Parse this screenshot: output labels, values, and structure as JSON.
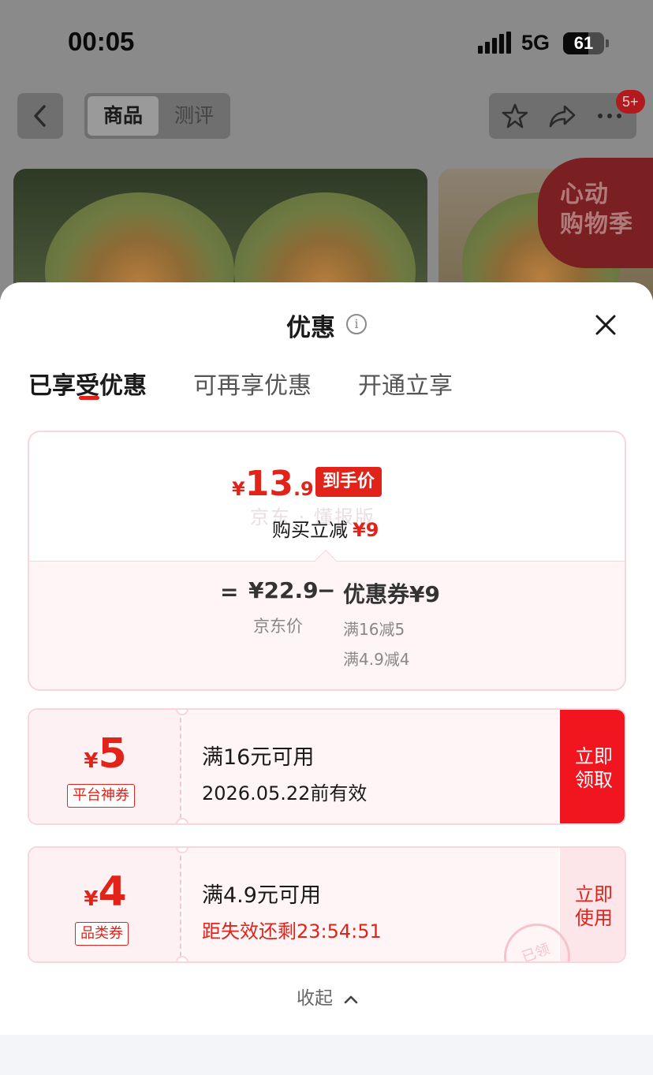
{
  "status_bar": {
    "time": "00:05",
    "network": "5G",
    "battery": "61"
  },
  "top_nav": {
    "tabs": [
      "商品",
      "测评"
    ],
    "active_tab": "商品",
    "more_badge": "5+",
    "promo_banner": "心动\n购物季"
  },
  "sheet": {
    "title": "优惠",
    "tabs": [
      {
        "label": "已享受优惠",
        "active": true
      },
      {
        "label": "可再享优惠",
        "active": false
      },
      {
        "label": "开通立享",
        "active": false
      }
    ]
  },
  "summary": {
    "price_yen": "¥",
    "price_int": "13",
    "price_dec": ".9",
    "price_tag": "到手价",
    "watermark": "京东 · 懂报版",
    "reduce_label": "购买立减",
    "reduce_value": "¥9",
    "equals": "=",
    "jd_price": "¥22.9",
    "jd_label": "京东价",
    "minus": "−",
    "coupon_total": "优惠券¥9",
    "rules": [
      "满16减5",
      "满4.9减4"
    ]
  },
  "coupons": [
    {
      "yen": "¥",
      "amount": "5",
      "type": "平台神券",
      "condition": "满16元可用",
      "subtext": "2026.05.22前有效",
      "button": "立即\n领取",
      "button_style": "solid"
    },
    {
      "yen": "¥",
      "amount": "4",
      "type": "品类券",
      "condition": "满4.9元可用",
      "subtext": "距失效还剩23:54:51",
      "button": "立即\n使用",
      "button_style": "soft",
      "stamp": "已领"
    }
  ],
  "collapse_label": "收起",
  "colors": {
    "accent": "#e2231a",
    "coupon_border": "#f8d6dc",
    "coupon_bg": "#fff5f7"
  },
  "icons": [
    "back-icon",
    "star-icon",
    "share-icon",
    "more-icon",
    "info-icon",
    "close-icon",
    "chevron-up-icon"
  ]
}
